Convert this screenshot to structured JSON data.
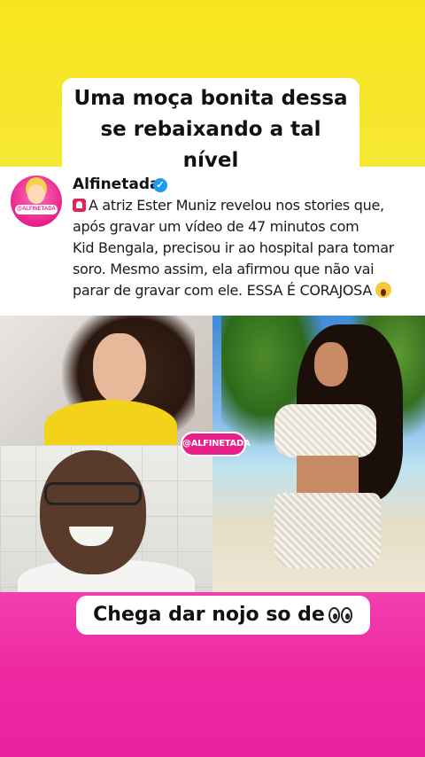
{
  "top_caption": {
    "line1": "Uma moça bonita dessa",
    "line2": "se rebaixando a tal nível"
  },
  "post": {
    "account_name": "Alfinetada",
    "verified": true,
    "avatar_tag": "@ALFINETADA",
    "text_lines": [
      "A atriz Ester Muniz revelou nos stories que,",
      "após gravar um vídeo de 47 minutos com",
      "Kid Bengala, precisou ir ao hospital para tomar",
      "soro.  Mesmo assim, ela afirmou que não vai",
      "parar de gravar com ele. ESSA É CORAJOSA"
    ],
    "leading_icon": "rotating-light-icon",
    "trailing_icon": "screaming-face-icon"
  },
  "photos": {
    "watermark": "@ALFINETADA",
    "items": [
      "woman-selfie-photo",
      "man-laughing-photo",
      "woman-beach-photo"
    ]
  },
  "bottom_caption": {
    "text": "Chega dar nojo so de",
    "trailing_icon": "eyes-icon"
  },
  "colors": {
    "top_band": "#f7e51c",
    "bottom_band": "#ee2aa3",
    "verified": "#1d9bf0",
    "watermark": "#e9208a"
  }
}
